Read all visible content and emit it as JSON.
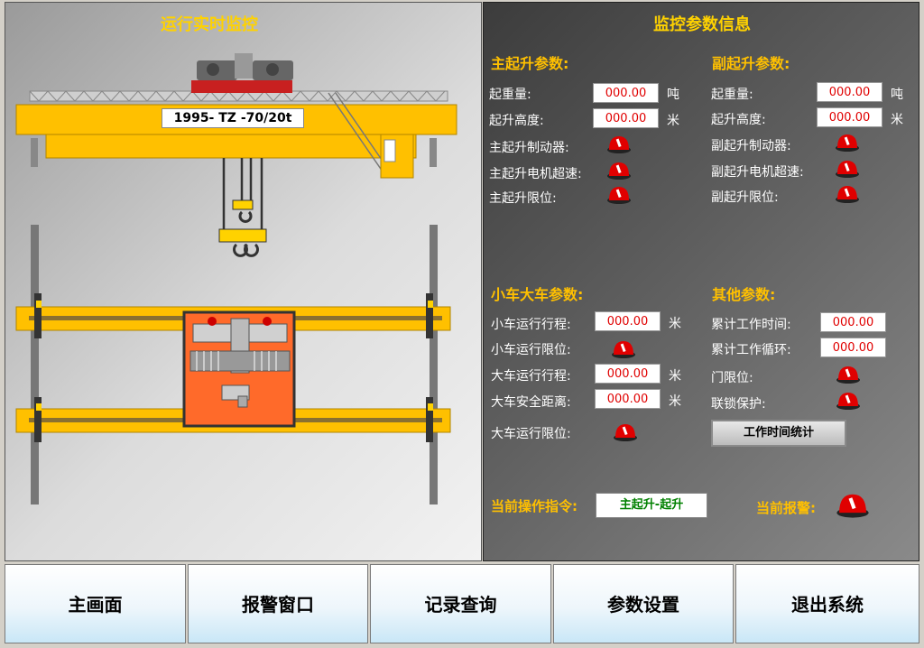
{
  "left": {
    "title": "运行实时监控",
    "crane_plate": "1995- TZ -70/20t"
  },
  "right": {
    "title": "监控参数信息",
    "main_hoist": {
      "title": "主起升参数:",
      "weight_label": "起重量:",
      "weight_value": "000.00",
      "weight_unit": "吨",
      "height_label": "起升高度:",
      "height_value": "000.00",
      "height_unit": "米",
      "brake_label": "主起升制动器:",
      "overspeed_label": "主起升电机超速:",
      "limit_label": "主起升限位:"
    },
    "aux_hoist": {
      "title": "副起升参数:",
      "weight_label": "起重量:",
      "weight_value": "000.00",
      "weight_unit": "吨",
      "height_label": "起升高度:",
      "height_value": "000.00",
      "height_unit": "米",
      "brake_label": "副起升制动器:",
      "overspeed_label": "副起升电机超速:",
      "limit_label": "副起升限位:"
    },
    "trolley": {
      "title": "小车大车参数:",
      "trolley_travel_label": "小车运行行程:",
      "trolley_travel_value": "000.00",
      "trolley_travel_unit": "米",
      "trolley_limit_label": "小车运行限位:",
      "bridge_travel_label": "大车运行行程:",
      "bridge_travel_value": "000.00",
      "bridge_travel_unit": "米",
      "bridge_safety_label": "大车安全距离:",
      "bridge_safety_value": "000.00",
      "bridge_safety_unit": "米",
      "bridge_limit_label": "大车运行限位:"
    },
    "other": {
      "title": "其他参数:",
      "work_time_label": "累计工作时间:",
      "work_time_value": "000.00",
      "work_cycle_label": "累计工作循环:",
      "work_cycle_value": "000.00",
      "door_limit_label": "门限位:",
      "interlock_label": "联锁保护:",
      "stats_button": "工作时间统计"
    },
    "current_cmd_label": "当前操作指令:",
    "current_cmd_value": "主起升-起升",
    "current_alarm_label": "当前报警:"
  },
  "nav": [
    "主画面",
    "报警窗口",
    "记录查询",
    "参数设置",
    "退出系统"
  ],
  "colors": {
    "accent": "#ffc000",
    "lamp": "#e00000",
    "beam": "#ffc000",
    "trolley": "#ff6a2a"
  }
}
